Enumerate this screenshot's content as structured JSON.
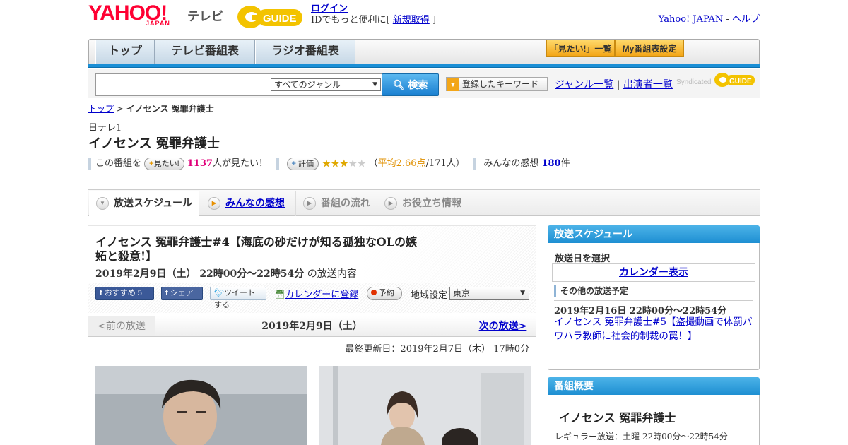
{
  "header": {
    "yahoo_logo": "YAHOO!",
    "japan_logo": "JAPAN",
    "tv_label": "テレビ",
    "gguide_logo": "G-GUIDE",
    "login": "ログイン",
    "login_note_prefix": "IDでもっと便利に[",
    "signup": "新規取得",
    "login_note_suffix": "]",
    "yahoo_japan_link": "Yahoo! JAPAN",
    "separator": "-",
    "help_link": "ヘルプ"
  },
  "nav": {
    "top": "トップ",
    "tv_schedule": "テレビ番組表",
    "radio_schedule": "ラジオ番組表",
    "mitai_list": "「見たい!」一覧",
    "my_schedule": "My番組表設定"
  },
  "search": {
    "genre_value": "すべてのジャンル",
    "button": "検索",
    "keyword_button": "登録したキーワード",
    "genre_list": "ジャンル一覧",
    "divider": "|",
    "performer_list": "出演者一覧",
    "syndicated": "Syndicated"
  },
  "breadcrumb": {
    "top": "トップ",
    "sep": ">",
    "current": "イノセンス 冤罪弁護士"
  },
  "program": {
    "channel": "日テレ1",
    "title": "イノセンス 冤罪弁護士",
    "want_prefix": "この番組を",
    "want_button": "見たい!",
    "want_count": "1137",
    "want_suffix": "人が見たい！",
    "rate_button": "評価",
    "rating_open": "（",
    "rating_avg": "平均2.66点",
    "rating_count": "/171人）",
    "rating_value": 2.66,
    "impressions_label": "みんなの感想",
    "impressions_count": "180",
    "impressions_unit": "件"
  },
  "tabs": {
    "schedule": "放送スケジュール",
    "impressions": "みんなの感想",
    "flow": "番組の流れ",
    "info": "お役立ち情報"
  },
  "episode": {
    "title": "イノセンス 冤罪弁護士#4【海底の砂だけが知る孤独なOLの嫉妬と殺意!】",
    "date": "2019年2月9日（土） 22時00分～22時54分",
    "date_suffix": "の放送内容",
    "recommend": "おすすめ 5",
    "share": "シェア",
    "tweet": "ツイートする",
    "calendar": "カレンダーに登録",
    "reserve": "予約",
    "region_label": "地域設定",
    "region_value": "東京"
  },
  "broadcast_nav": {
    "prev": "<前の放送",
    "current": "2019年2月9日（土）",
    "next": "次の放送>",
    "updated": "最終更新日：2019年2月7日（木） 17時0分"
  },
  "sidebar": {
    "schedule_head": "放送スケジュール",
    "select_date": "放送日を選択",
    "calendar_button": "カレンダー表示",
    "other_head": "その他の放送予定",
    "other_date": "2019年2月16日 22時00分～22時54分",
    "other_link": "イノセンス 冤罪弁護士#5【盗撮動画で体罰パワハラ教師に社会的制裁の罠！】",
    "overview_head": "番組概要",
    "overview_title": "イノセンス 冤罪弁護士",
    "regular": "レギュラー放送：土曜 22時00分～22時54分"
  },
  "colors": {
    "accent_blue": "#1a8fd6",
    "yahoo_red": "#ff0033",
    "gguide_yellow": "#f3c300",
    "highlight_pink": "#e0007a"
  }
}
